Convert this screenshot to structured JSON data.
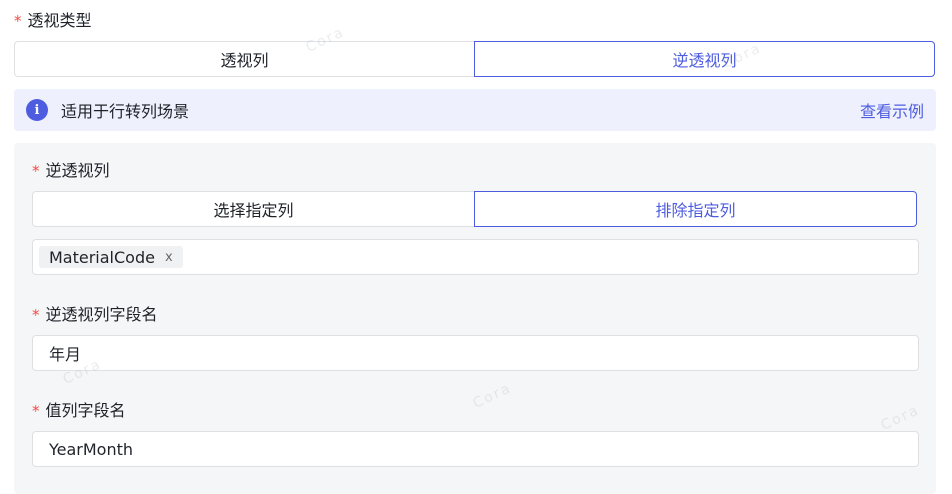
{
  "pivot_type": {
    "label": "透视类型",
    "options": [
      "透视列",
      "逆透视列"
    ],
    "selected": "逆透视列"
  },
  "info_banner": {
    "text": "适用于行转列场景",
    "link": "查看示例"
  },
  "unpivot_columns": {
    "label": "逆透视列",
    "options": [
      "选择指定列",
      "排除指定列"
    ],
    "selected": "排除指定列",
    "tags": [
      "MaterialCode"
    ],
    "tag_remove": "x"
  },
  "unpivot_field_name": {
    "label": "逆透视列字段名",
    "value": "年月"
  },
  "value_field_name": {
    "label": "值列字段名",
    "value": "YearMonth"
  },
  "watermark": "Cora",
  "colors": {
    "accent": "#4e5de0",
    "required": "#f54a45",
    "banner_bg": "#eef0fd",
    "panel_bg": "#f5f6f8"
  }
}
